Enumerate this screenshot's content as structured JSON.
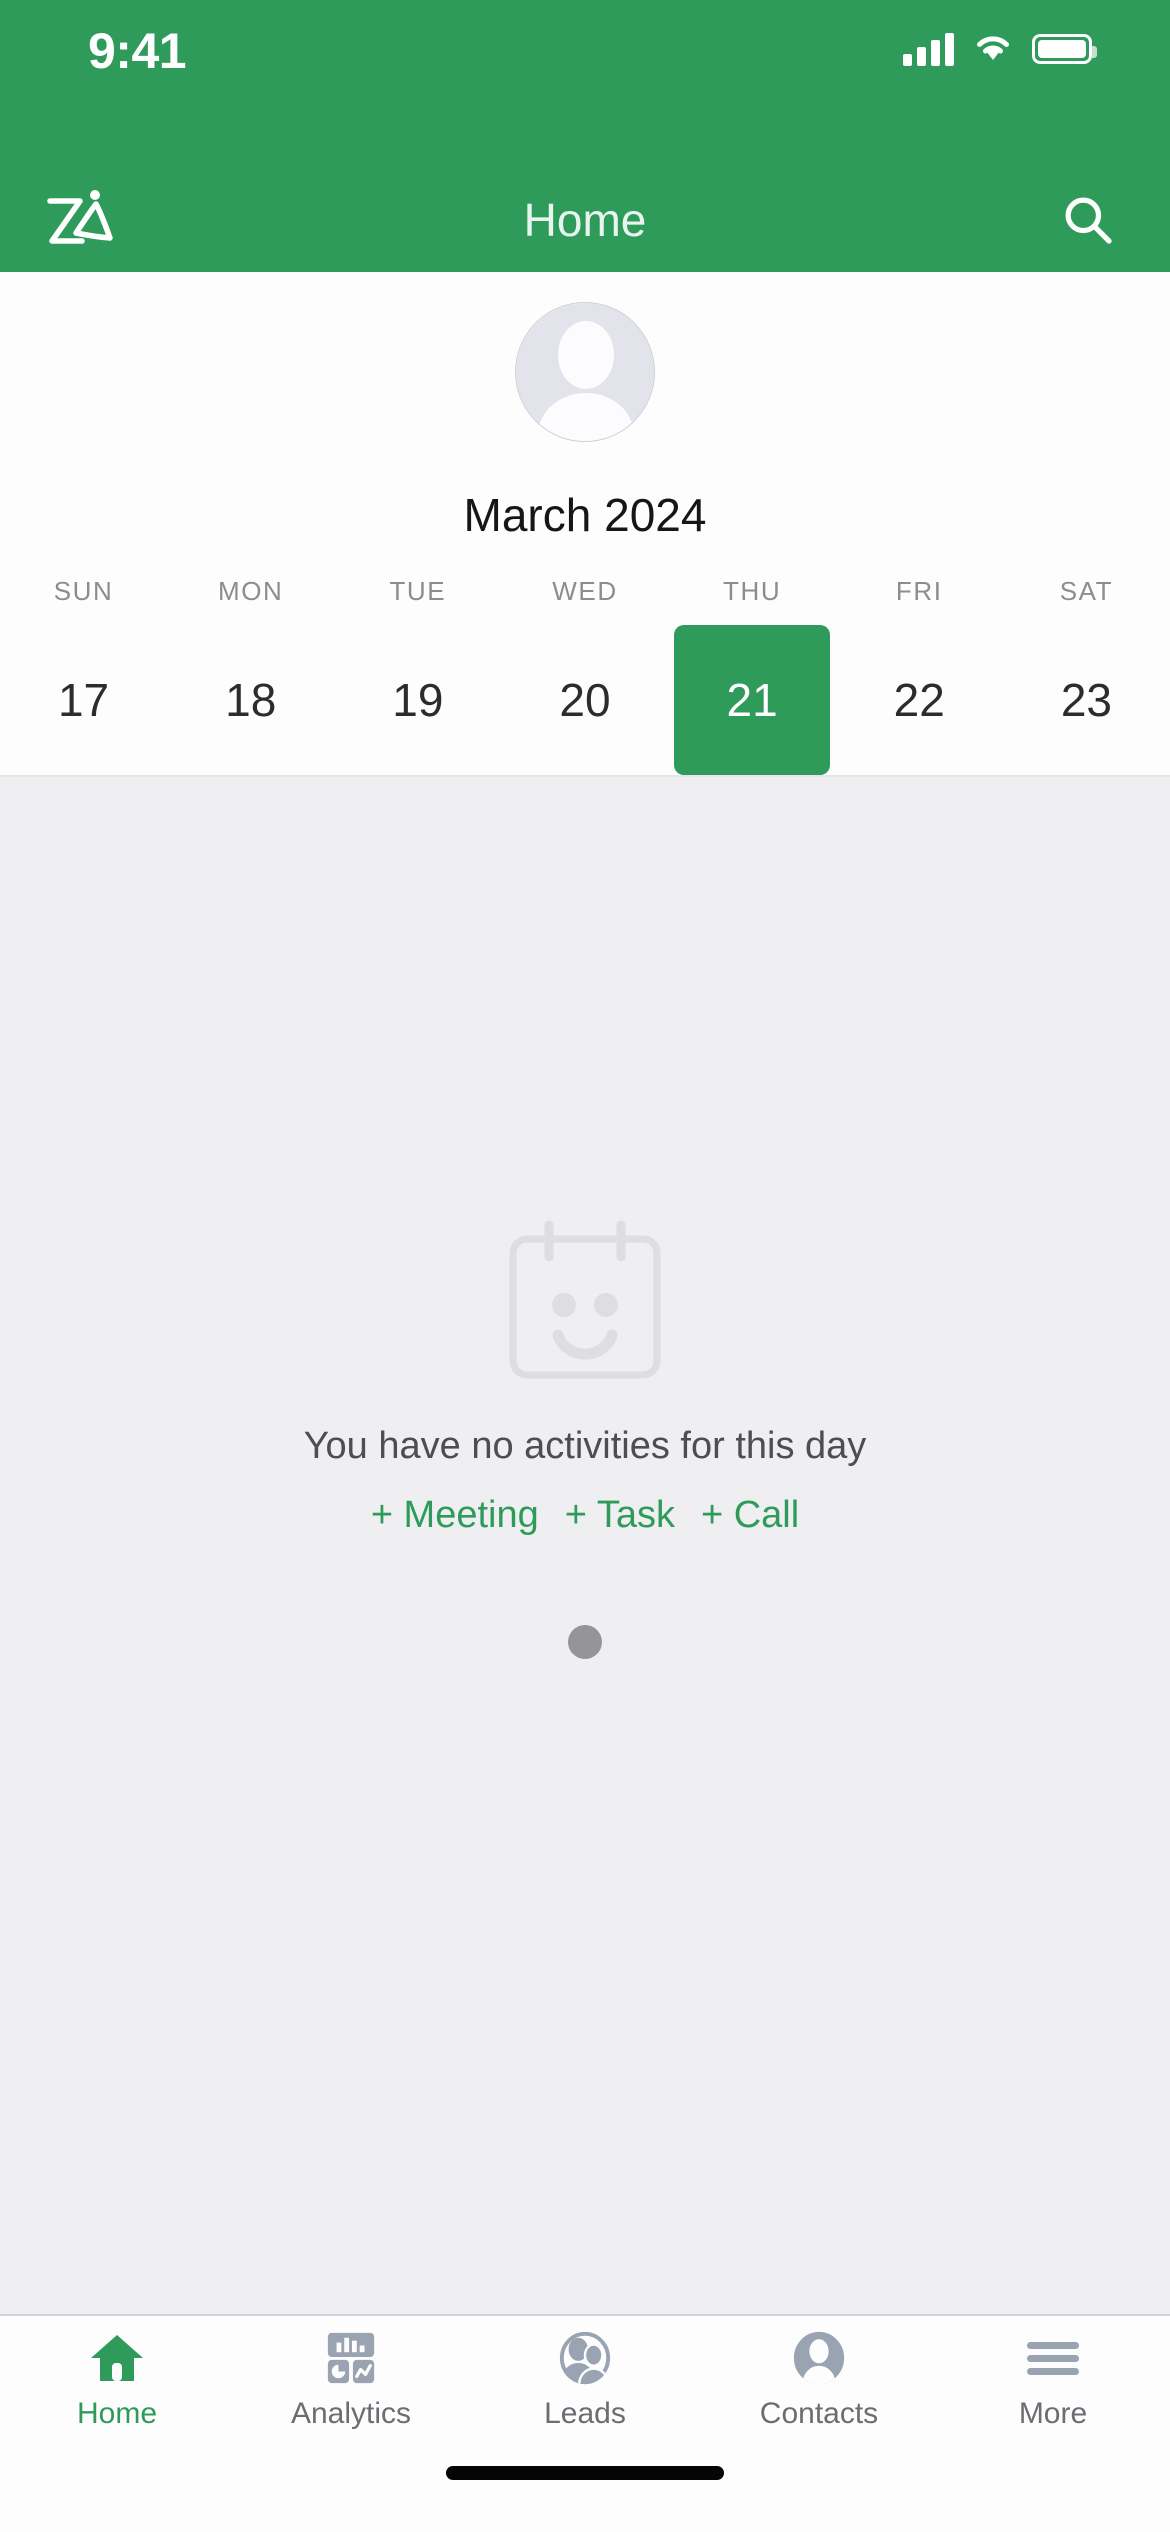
{
  "status_bar": {
    "time": "9:41",
    "icons": [
      "cellular-signal-icon",
      "wifi-icon",
      "battery-icon"
    ]
  },
  "nav_bar": {
    "logo_name": "zia-logo",
    "title": "Home",
    "search_icon": "search-icon",
    "background_color": "#2F9B5B"
  },
  "profile": {
    "avatar_alt": "default-user-avatar"
  },
  "calendar": {
    "month_label": "March 2024",
    "weekdays": [
      "SUN",
      "MON",
      "TUE",
      "WED",
      "THU",
      "FRI",
      "SAT"
    ],
    "days": [
      {
        "num": "17",
        "selected": false
      },
      {
        "num": "18",
        "selected": false
      },
      {
        "num": "19",
        "selected": false
      },
      {
        "num": "20",
        "selected": false
      },
      {
        "num": "21",
        "selected": true
      },
      {
        "num": "22",
        "selected": false
      },
      {
        "num": "23",
        "selected": false
      }
    ],
    "selected_day": "21",
    "selected_color": "#2F9B5B"
  },
  "empty_state": {
    "icon_name": "calendar-smiley-icon",
    "message": "You have no activities for this day",
    "actions": [
      {
        "label": "+ Meeting",
        "name": "add-meeting-link"
      },
      {
        "label": "+ Task",
        "name": "add-task-link"
      },
      {
        "label": "+ Call",
        "name": "add-call-link"
      }
    ],
    "accent_color": "#2F9B5B"
  },
  "pager": {
    "dots": 1,
    "active_index": 0
  },
  "tab_bar": {
    "active": "Home",
    "items": [
      {
        "label": "Home",
        "icon": "house-icon",
        "active": true
      },
      {
        "label": "Analytics",
        "icon": "dashboard-chart-icon",
        "active": false
      },
      {
        "label": "Leads",
        "icon": "two-people-icon",
        "active": false
      },
      {
        "label": "Contacts",
        "icon": "person-icon",
        "active": false
      },
      {
        "label": "More",
        "icon": "hamburger-menu-icon",
        "active": false
      }
    ]
  },
  "system": {
    "home_indicator": "home-indicator-bar"
  }
}
